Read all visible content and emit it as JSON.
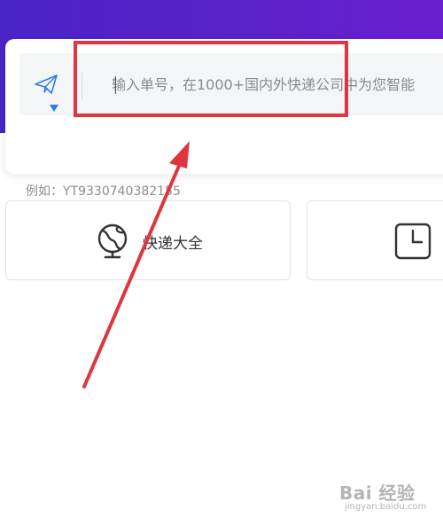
{
  "search": {
    "placeholder": "输入单号，在1000+国内外快递公司中为您智能",
    "value": "",
    "example": "例如：YT9330740382155"
  },
  "services": [
    {
      "label": "快递大全",
      "icon": "globe-icon"
    },
    {
      "label": "",
      "icon": "clock-icon"
    }
  ],
  "annotation": {
    "box_color": "#e0353d",
    "arrow_color": "#e0353d"
  },
  "watermark": {
    "brand": "Bai 经验",
    "url": "jingyan.baidu.com"
  },
  "colors": {
    "header_gradient_start": "#4a24c7",
    "header_gradient_end": "#6a1fd0",
    "accent": "#2f7be5"
  }
}
